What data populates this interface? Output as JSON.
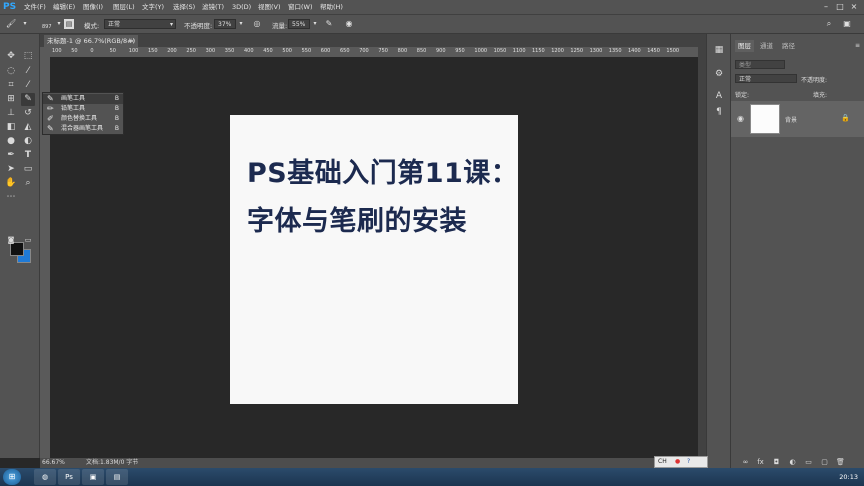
{
  "app": {
    "logo": "PS"
  },
  "menu": [
    "文件(F)",
    "编辑(E)",
    "图像(I)",
    "图层(L)",
    "文字(Y)",
    "选择(S)",
    "滤镜(T)",
    "3D(D)",
    "视图(V)",
    "窗口(W)",
    "帮助(H)"
  ],
  "window_controls": [
    "minimize-icon",
    "maximize-icon",
    "close-icon"
  ],
  "options": {
    "brush_size": "897",
    "mode_label": "模式:",
    "mode_value": "正常",
    "opacity_label": "不透明度:",
    "opacity_value": "37%",
    "flow_label": "流量:",
    "flow_value": "55%"
  },
  "document": {
    "tab_title": "未标题-1 @ 66.7%(RGB/8#)",
    "close": "×",
    "ruler_ticks": [
      "100",
      "50",
      "0",
      "50",
      "100",
      "150",
      "200",
      "250",
      "300",
      "350",
      "400",
      "450",
      "500",
      "550",
      "600",
      "650",
      "700",
      "750",
      "800",
      "850",
      "900",
      "950",
      "1000",
      "1050",
      "1100",
      "1150",
      "1200",
      "1250",
      "1300",
      "1350",
      "1400",
      "1450",
      "1500"
    ],
    "canvas_text": [
      "PS基础入门第11课：",
      "字体与笔刷的安装"
    ]
  },
  "flyout": [
    {
      "icon": "brush-icon",
      "label": "画笔工具",
      "key": "B"
    },
    {
      "icon": "pencil-icon",
      "label": "铅笔工具",
      "key": "B"
    },
    {
      "icon": "color-replace-icon",
      "label": "颜色替换工具",
      "key": "B"
    },
    {
      "icon": "mixer-brush-icon",
      "label": "混合器画笔工具",
      "key": "B"
    }
  ],
  "status": {
    "zoom": "66.67%",
    "doc_info": "文档:1.83M/0 字节"
  },
  "layers_panel": {
    "tabs": [
      "图层",
      "通道",
      "路径"
    ],
    "kind_placeholder": "类型",
    "blend_mode": "正常",
    "opacity_label": "不透明度:",
    "lock_label": "锁定:",
    "fill_label": "填充:",
    "layer_name": "背景"
  },
  "taskbar": {
    "ime": "CH",
    "clock": "20:13"
  },
  "colors": {
    "foreground": "#111111",
    "background": "#1f7ad6",
    "canvas_text": "#1c2a4f"
  }
}
